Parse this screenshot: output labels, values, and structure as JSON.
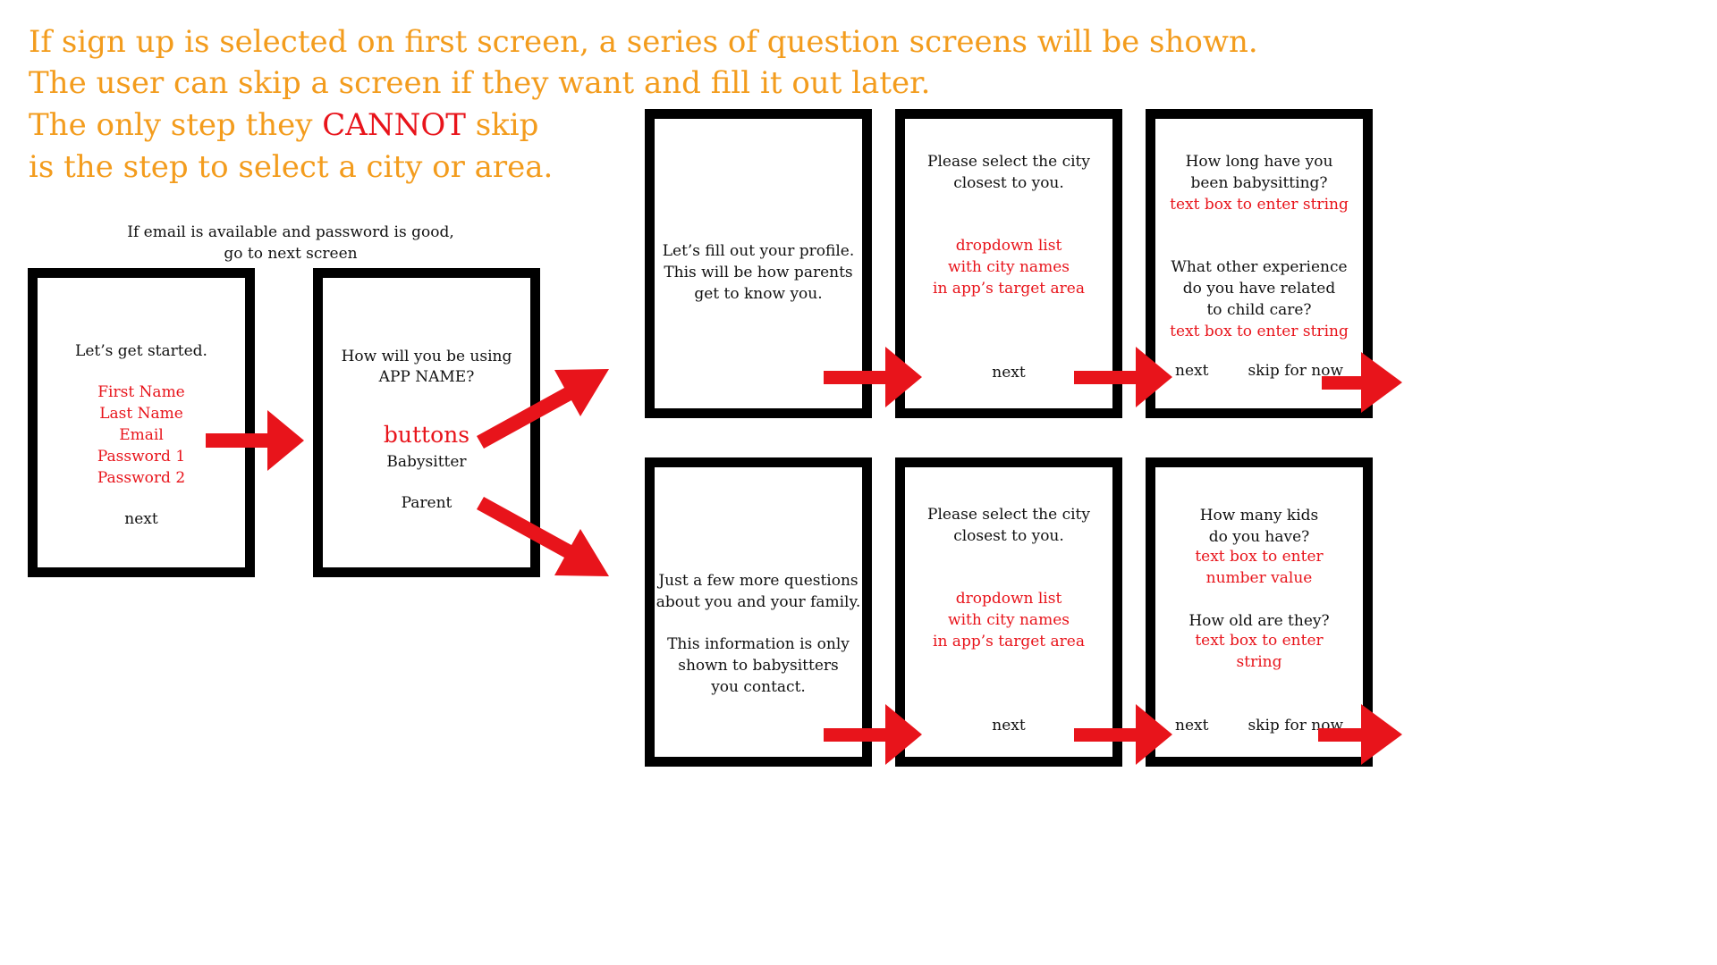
{
  "intro": {
    "line1": "If sign up is selected on first screen, a series of question screens will be shown.",
    "line2": "The user can skip a screen if they want and fill it out later.",
    "line3_pre": "The only step they ",
    "line3_emph": "CANNOT",
    "line3_post": " skip",
    "line4": "is the step to select a city or area."
  },
  "note": {
    "line1": "If email is available and password is good,",
    "line2": "go to next screen"
  },
  "screen1": {
    "title": "Let’s get started.",
    "fields": [
      "First Name",
      "Last Name",
      "Email",
      "Password 1",
      "Password 2"
    ],
    "next": "next"
  },
  "screen2": {
    "q1": "How will you be using",
    "q2": "APP NAME?",
    "buttons_label": "buttons",
    "option1": "Babysitter",
    "option2": "Parent"
  },
  "sitter": {
    "intro": [
      "Let’s fill out your profile.",
      "This will be how parents",
      "get to know you."
    ],
    "city": {
      "q": [
        "Please select the city",
        "closest to you."
      ],
      "dropdown": [
        "dropdown list",
        "with city names",
        "in app’s target area"
      ],
      "next": "next"
    },
    "experience": {
      "q1": [
        "How long have you",
        "been babysitting?"
      ],
      "a1": "text box to enter string",
      "q2": [
        "What other experience",
        "do you have related",
        "to child care?"
      ],
      "a2": "text box to enter string",
      "next": "next",
      "skip": "skip for now"
    }
  },
  "parent": {
    "intro": [
      "Just a few more questions",
      "about you and your family."
    ],
    "intro2": [
      "This information is only",
      "shown to babysitters",
      "you contact."
    ],
    "city": {
      "q": [
        "Please select the city",
        "closest to you."
      ],
      "dropdown": [
        "dropdown list",
        "with city names",
        "in app’s target area"
      ],
      "next": "next"
    },
    "kids": {
      "q1": [
        "How many kids",
        "do you have?"
      ],
      "a1": [
        "text box to enter",
        "number value"
      ],
      "q2": "How old are they?",
      "a2": [
        "text box to enter",
        "string"
      ],
      "next": "next",
      "skip": "skip for now"
    }
  },
  "colors": {
    "orange": "#f39c1d",
    "red": "#e8141b",
    "black": "#000000"
  }
}
